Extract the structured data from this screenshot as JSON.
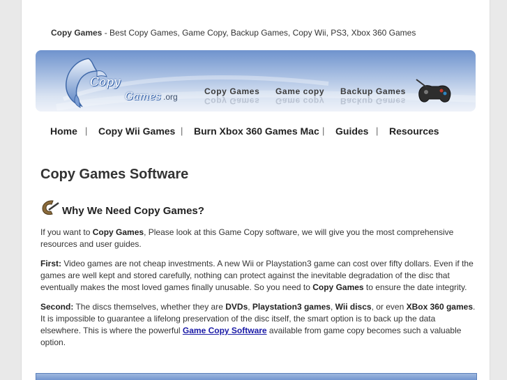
{
  "header": {
    "site_name": "Copy Games",
    "tagline_rest": " - Best Copy Games, Game Copy, Backup Games, Copy Wii, PS3, Xbox 360 Games"
  },
  "banner": {
    "logo_copy": "Copy",
    "logo_games": "Games",
    "logo_org": ".org",
    "links": [
      "Copy Games",
      "Game copy",
      "Backup Games"
    ]
  },
  "nav": {
    "items": [
      "Home",
      "Copy Wii Games",
      "Burn Xbox 360 Games Mac",
      "Guides",
      "Resources"
    ],
    "separator": "|"
  },
  "main": {
    "title": "Copy Games Software",
    "subtitle": "Why We Need Copy Games?",
    "p1": {
      "a": "If you want to ",
      "b": "Copy Games",
      "c": ", Please look at this Game Copy software, we will give you the most comprehensive resources and user guides."
    },
    "p2": {
      "label": "First:",
      "a": " Video games are not cheap investments. A new Wii or Playstation3 game can cost over fifty dollars. Even if the games are well kept and stored carefully, nothing can protect against the inevitable degradation of the disc that eventually makes the most loved games finally unusable. So you need to ",
      "b": "Copy Games",
      "c": " to ensure the date integrity."
    },
    "p3": {
      "label": "Second:",
      "a": " The discs themselves, whether they are ",
      "dvds": "DVDs",
      "comma1": ", ",
      "ps3": "Playstation3 games",
      "comma2": ", ",
      "wii": "Wii discs",
      "or": ", or even ",
      "xbox": "XBox 360 games",
      "b": ". It is impossible to guarantee a lifelong preservation of the disc itself, the smart option is to back up the data elsewhere. This is where the powerful ",
      "link": "Game Copy Software",
      "c": " available from game copy becomes such a valuable option."
    }
  }
}
